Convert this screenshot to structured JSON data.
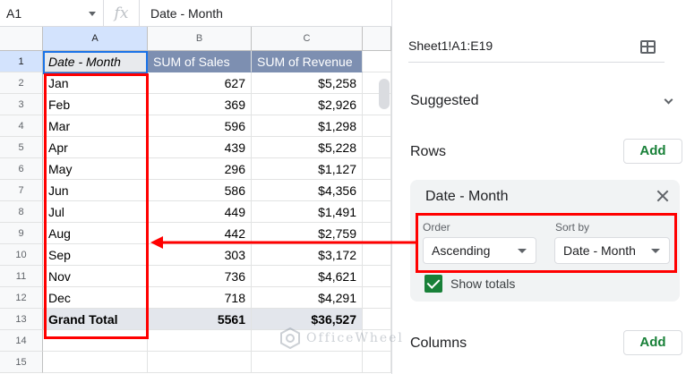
{
  "formula_bar": {
    "name_box": "A1",
    "fx": "fx",
    "content": "Date - Month"
  },
  "columns": [
    "A",
    "B",
    "C"
  ],
  "row_numbers": [
    "1",
    "2",
    "3",
    "4",
    "5",
    "6",
    "7",
    "8",
    "9",
    "10",
    "11",
    "12",
    "13",
    "14",
    "15"
  ],
  "pivot": {
    "headers": [
      "Date - Month",
      "SUM of Sales",
      "SUM of Revenue"
    ],
    "rows": [
      {
        "month": "Jan",
        "sales": "627",
        "revenue": "$5,258"
      },
      {
        "month": "Feb",
        "sales": "369",
        "revenue": "$2,926"
      },
      {
        "month": "Mar",
        "sales": "596",
        "revenue": "$1,298"
      },
      {
        "month": "Apr",
        "sales": "439",
        "revenue": "$5,228"
      },
      {
        "month": "May",
        "sales": "296",
        "revenue": "$1,127"
      },
      {
        "month": "Jun",
        "sales": "586",
        "revenue": "$4,356"
      },
      {
        "month": "Jul",
        "sales": "449",
        "revenue": "$1,491"
      },
      {
        "month": "Aug",
        "sales": "442",
        "revenue": "$2,759"
      },
      {
        "month": "Sep",
        "sales": "303",
        "revenue": "$3,172"
      },
      {
        "month": "Nov",
        "sales": "736",
        "revenue": "$4,621"
      },
      {
        "month": "Dec",
        "sales": "718",
        "revenue": "$4,291"
      }
    ],
    "total": {
      "label": "Grand Total",
      "sales": "5561",
      "revenue": "$36,527"
    }
  },
  "editor": {
    "range": "Sheet1!A1:E19",
    "suggested": "Suggested",
    "rows_label": "Rows",
    "add": "Add",
    "row_field": {
      "title": "Date - Month",
      "order_label": "Order",
      "order_value": "Ascending",
      "sort_by_label": "Sort by",
      "sort_by_value": "Date - Month",
      "show_totals": "Show totals"
    },
    "columns_label": "Columns"
  },
  "watermark": "OfficeWheel",
  "colors": {
    "header_fill": "#7d8fb1",
    "total_fill": "#e3e6ec",
    "highlight": "#ff0000",
    "accent_green": "#188038"
  }
}
